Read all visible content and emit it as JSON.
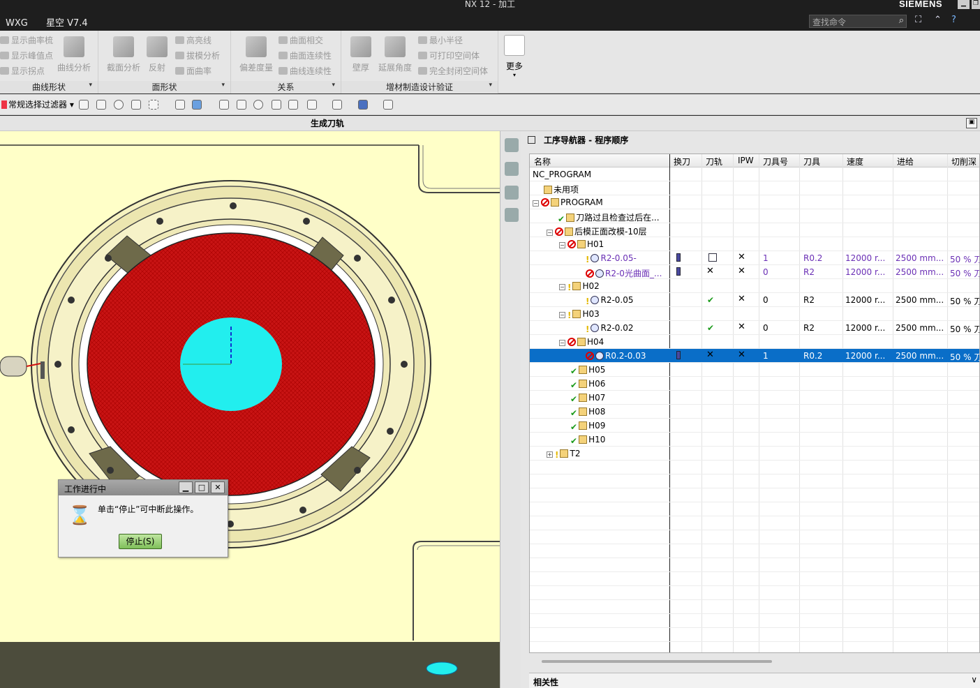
{
  "window": {
    "title": "NX 12 - 加工",
    "brand": "SIEMENS",
    "menu": [
      "WXG",
      "星空 V7.4"
    ]
  },
  "search": {
    "placeholder": "查找命令"
  },
  "ribbon": {
    "curve_shape": {
      "label": "曲线形状",
      "items": [
        "显示曲率梳",
        "显示峰值点",
        "显示拐点"
      ],
      "big": "曲线分析"
    },
    "surface_shape": {
      "label": "面形状",
      "big1": "截面分析",
      "big2": "反射",
      "items": [
        "高亮线",
        "拔模分析",
        "面曲率"
      ]
    },
    "relation": {
      "label": "关系",
      "big": "偏差度量",
      "items": [
        "曲面相交",
        "曲面连续性",
        "曲线连续性"
      ]
    },
    "additive": {
      "label": "增材制造设计验证",
      "big1": "壁厚",
      "big2": "延展角度",
      "items": [
        "最小半径",
        "可打印空间体",
        "完全封闭空间体"
      ]
    },
    "more": "更多"
  },
  "toolbar": {
    "filter": "常规选择过滤器"
  },
  "gen_title": "生成刀轨",
  "navigator": {
    "title": "工序导航器 - 程序顺序",
    "columns": [
      "名称",
      "换刀",
      "刀轨",
      "IPW",
      "刀具号",
      "刀具",
      "速度",
      "进给",
      "切削深"
    ],
    "rows": [
      {
        "name": "NC_PROGRAM"
      },
      {
        "name": "未用项"
      },
      {
        "name": "PROGRAM"
      },
      {
        "name": "刀路过且检查过后在..."
      },
      {
        "name": "后模正面改模-10层"
      },
      {
        "name": "H01"
      },
      {
        "name": "R2-0.05-",
        "tool_no": "1",
        "tool": "R0.2",
        "speed": "12000 r...",
        "feed": "2500 mm...",
        "depth": "50 % 刀"
      },
      {
        "name": "R2-0光曲面_...",
        "tool_no": "0",
        "tool": "R2",
        "speed": "12000 r...",
        "feed": "2500 mm...",
        "depth": "50 % 刀"
      },
      {
        "name": "H02"
      },
      {
        "name": "R2-0.05",
        "tool_no": "0",
        "tool": "R2",
        "speed": "12000 r...",
        "feed": "2500 mm...",
        "depth": "50 % 刀"
      },
      {
        "name": "H03"
      },
      {
        "name": "R2-0.02",
        "tool_no": "0",
        "tool": "R2",
        "speed": "12000 r...",
        "feed": "2500 mm...",
        "depth": "50 % 刀"
      },
      {
        "name": "H04"
      },
      {
        "name": "R0.2-0.03",
        "tool_no": "1",
        "tool": "R0.2",
        "speed": "12000 r...",
        "feed": "2500 mm...",
        "depth": "50 % 刀"
      },
      {
        "name": "H05"
      },
      {
        "name": "H06"
      },
      {
        "name": "H07"
      },
      {
        "name": "H08"
      },
      {
        "name": "H09"
      },
      {
        "name": "H10"
      },
      {
        "name": "T2"
      }
    ]
  },
  "relevance": {
    "title": "相关性"
  },
  "dialog": {
    "title": "工作进行中",
    "message": "单击“停止”可中断此操作。",
    "stop": "停止(S)"
  }
}
